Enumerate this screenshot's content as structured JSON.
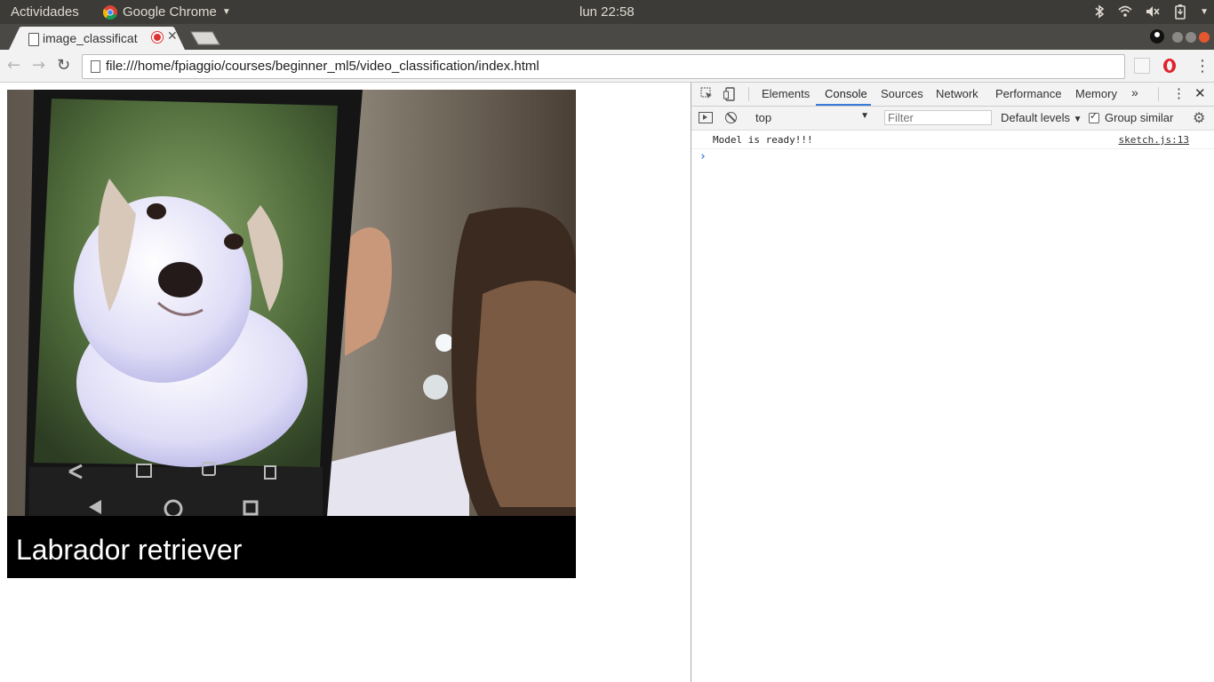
{
  "os_panel": {
    "activities": "Actividades",
    "app_name": "Google Chrome",
    "clock": "lun 22:58"
  },
  "browser": {
    "tab_title": "image_classificat",
    "url": "file:///home/fpiaggio/courses/beginner_ml5/video_classification/index.html"
  },
  "page": {
    "result_label": "Labrador retriever"
  },
  "devtools": {
    "tabs": [
      "Elements",
      "Console",
      "Sources",
      "Network",
      "Performance",
      "Memory"
    ],
    "active_tab": "Console",
    "context": "top",
    "filter_placeholder": "Filter",
    "levels": "Default levels",
    "group_similar": "Group similar",
    "group_similar_checked": true,
    "console_messages": [
      {
        "text": "Model is ready!!!",
        "source": "sketch.js:13"
      }
    ]
  },
  "icons": {
    "back": "arrow-left-icon",
    "forward": "arrow-right-icon",
    "reload": "reload-icon",
    "tray": [
      "bluetooth-icon",
      "wifi-icon",
      "volume-muted-icon",
      "battery-icon"
    ]
  },
  "colors": {
    "panel_bg": "#3c3b37",
    "devtools_accent": "#3879d9",
    "result_bg": "#000000"
  }
}
